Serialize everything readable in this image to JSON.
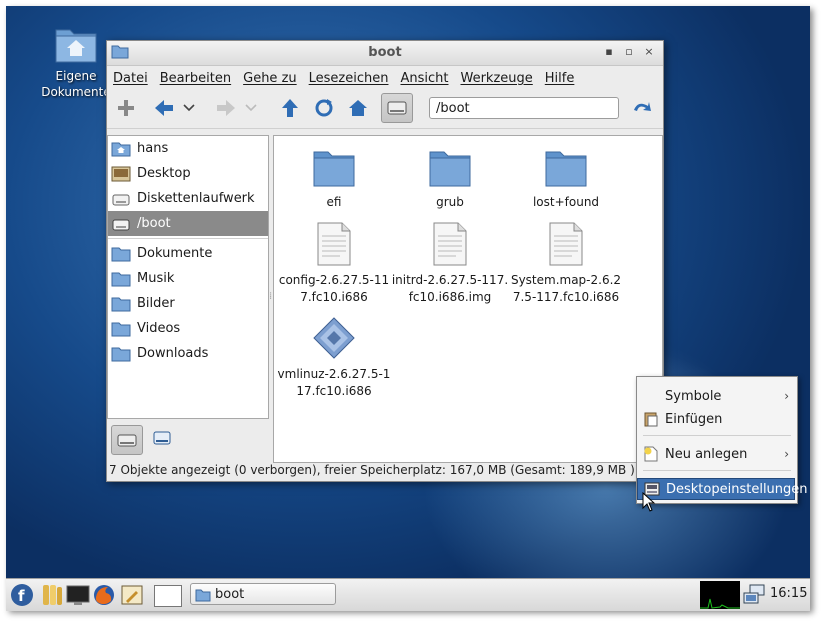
{
  "desktop": {
    "icon_label_line1": "Eigene",
    "icon_label_line2": "Dokumente"
  },
  "window": {
    "title": "boot",
    "controls": {
      "minimize": "▪",
      "maximize": "▫",
      "close": "×"
    },
    "menu": [
      "Datei",
      "Bearbeiten",
      "Gehe zu",
      "Lesezeichen",
      "Ansicht",
      "Werkzeuge",
      "Hilfe"
    ],
    "location": "/boot",
    "sidebar": {
      "places": [
        {
          "label": "hans",
          "icon": "home-folder-icon"
        },
        {
          "label": "Desktop",
          "icon": "desktop-icon"
        },
        {
          "label": "Diskettenlaufwerk",
          "icon": "floppy-drive-icon"
        },
        {
          "label": "/boot",
          "icon": "drive-icon",
          "selected": true
        }
      ],
      "bookmarks": [
        {
          "label": "Dokumente",
          "icon": "folder-icon"
        },
        {
          "label": "Musik",
          "icon": "folder-icon"
        },
        {
          "label": "Bilder",
          "icon": "folder-icon"
        },
        {
          "label": "Videos",
          "icon": "folder-icon"
        },
        {
          "label": "Downloads",
          "icon": "folder-icon"
        }
      ]
    },
    "files": [
      {
        "line1": "efi",
        "line2": "",
        "type": "folder"
      },
      {
        "line1": "grub",
        "line2": "",
        "type": "folder"
      },
      {
        "line1": "lost+found",
        "line2": "",
        "type": "folder"
      },
      {
        "line1": "config-2.6.27.5-11",
        "line2": "7.fc10.i686",
        "type": "text"
      },
      {
        "line1": "initrd-2.6.27.5-117.",
        "line2": "fc10.i686.img",
        "type": "text"
      },
      {
        "line1": "System.map-2.6.2",
        "line2": "7.5-117.fc10.i686",
        "type": "text"
      },
      {
        "line1": "vmlinuz-2.6.27.5-1",
        "line2": "17.fc10.i686",
        "type": "binary"
      }
    ],
    "status": "7 Objekte angezeigt (0 verborgen), freier Speicherplatz: 167,0 MB (Gesamt: 189,9 MB )"
  },
  "context_menu": [
    {
      "label": "Symbole",
      "submenu": true,
      "icon": ""
    },
    {
      "label": "Einfügen",
      "submenu": false,
      "icon": "paste-icon"
    },
    {
      "label": "Neu anlegen",
      "submenu": true,
      "icon": "new-file-icon"
    },
    {
      "label": "Desktopeinstellungen",
      "submenu": false,
      "icon": "desktop-settings-icon",
      "highlighted": true
    }
  ],
  "taskbar": {
    "task_label": "boot",
    "clock": "16:15"
  },
  "colors": {
    "selection": "#3b6fb0",
    "folder": "#7aa7d9",
    "sidebar_selected": "#8a8a8a"
  }
}
